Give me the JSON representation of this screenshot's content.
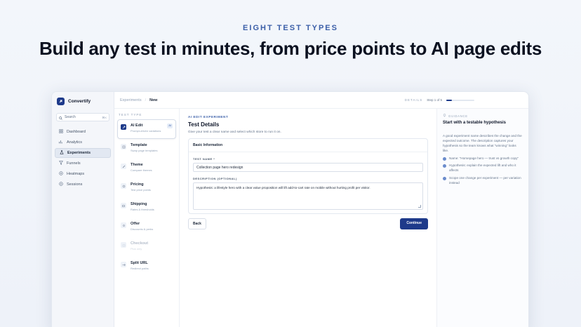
{
  "hero": {
    "eyebrow": "EIGHT TEST TYPES",
    "headline": "Build any test in minutes, from price points to AI page edits"
  },
  "sidebar": {
    "brand": "Convertify",
    "search_placeholder": "Search",
    "search_shortcut": "⌘K",
    "items": [
      {
        "label": "Dashboard",
        "icon": "grid-icon",
        "active": false
      },
      {
        "label": "Analytics",
        "icon": "chart-icon",
        "active": false
      },
      {
        "label": "Experiments",
        "icon": "flask-icon",
        "active": true
      },
      {
        "label": "Funnels",
        "icon": "funnel-icon",
        "active": false
      },
      {
        "label": "Heatmaps",
        "icon": "heat-icon",
        "active": false
      },
      {
        "label": "Sessions",
        "icon": "play-icon",
        "active": false
      }
    ]
  },
  "topbar": {
    "crumb_parent": "Experiments",
    "crumb_sep": "/",
    "crumb_current": "New",
    "details_label": "DETAILS",
    "step_label": "Step 1 of 5",
    "step_progress": 0.2
  },
  "types": {
    "title": "TEST TYPE",
    "items": [
      {
        "name": "AI Edit",
        "desc": "Prompt-driven variations",
        "badge": "AI",
        "active": true,
        "disabled": false
      },
      {
        "name": "Template",
        "desc": "Swap page templates",
        "active": false,
        "disabled": false
      },
      {
        "name": "Theme",
        "desc": "Compare themes",
        "active": false,
        "disabled": false
      },
      {
        "name": "Pricing",
        "desc": "Test price points",
        "active": false,
        "disabled": false
      },
      {
        "name": "Shipping",
        "desc": "Rates & thresholds",
        "active": false,
        "disabled": false
      },
      {
        "name": "Offer",
        "desc": "Discounts & perks",
        "active": false,
        "disabled": false
      },
      {
        "name": "Checkout",
        "desc": "Plus only",
        "active": false,
        "disabled": true
      },
      {
        "name": "Split URL",
        "desc": "Redirect paths",
        "active": false,
        "disabled": false
      }
    ]
  },
  "main": {
    "eyebrow": "AI EDIT EXPERIMENT",
    "title": "Test Details",
    "subtitle": "Give your test a clear name and select which store to run it on.",
    "card_title": "Basic Information",
    "name_label": "TEST NAME *",
    "name_value": "Collection page hero redesign",
    "desc_label": "DESCRIPTION (OPTIONAL)",
    "desc_value": "Hypothesis: a lifestyle hero with a clear value proposition will lift add-to-cart rate on mobile without hurting profit per visitor.",
    "back_label": "Back",
    "continue_label": "Continue"
  },
  "guidance": {
    "eyebrow": "GUIDANCE",
    "title": "Start with a testable hypothesis",
    "body": "A good experiment name describes the change and the expected outcome. The description captures your hypothesis so the team knows what \"winning\" looks like.",
    "bullets": [
      "Name: \"Homepage hero — trust vs growth copy\"",
      "Hypothesis: explain the expected lift and who it affects",
      "Scope one change per experiment — per variation instead"
    ]
  }
}
